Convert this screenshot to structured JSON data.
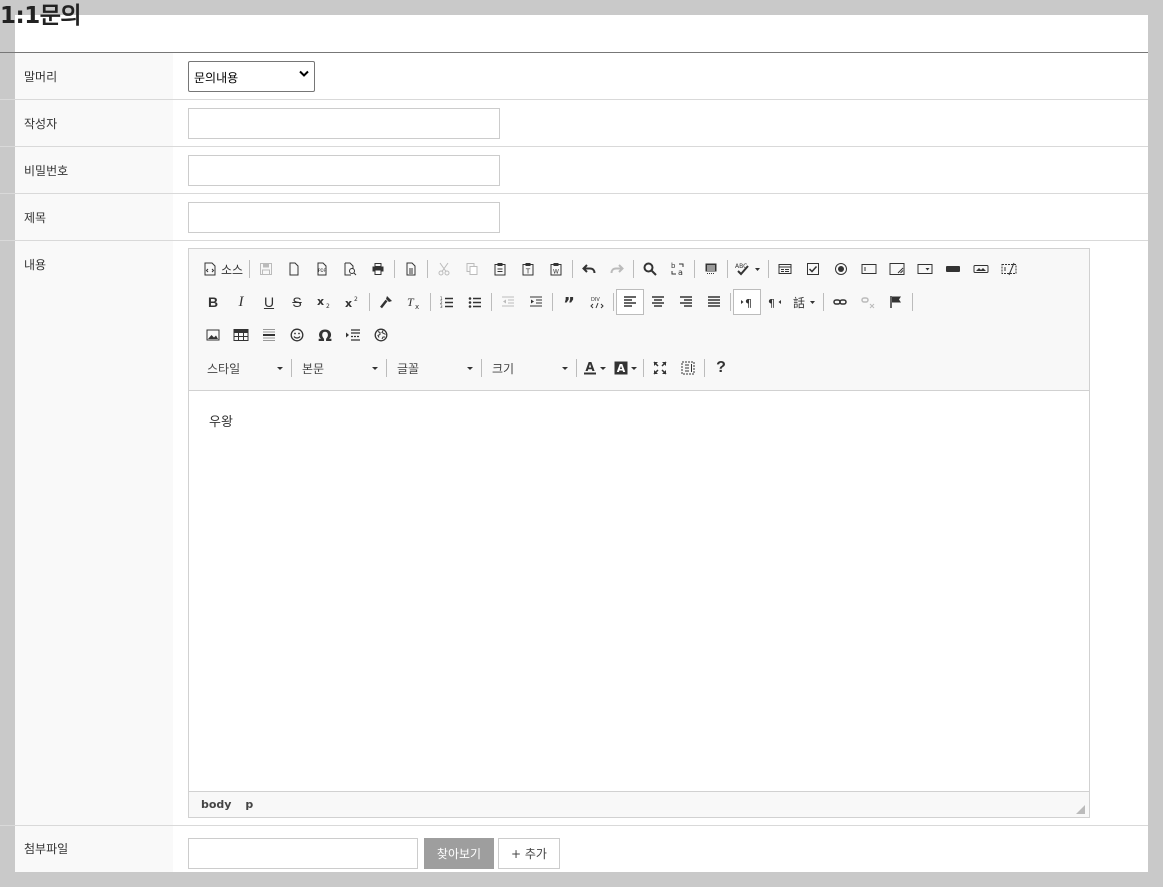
{
  "page": {
    "title": "1:1문의"
  },
  "form": {
    "header": {
      "label": "말머리",
      "selected": "문의내용"
    },
    "author": {
      "label": "작성자",
      "value": ""
    },
    "password": {
      "label": "비밀번호",
      "value": ""
    },
    "subject": {
      "label": "제목",
      "value": ""
    },
    "content": {
      "label": "내용"
    },
    "attachment": {
      "label": "첨부파일",
      "browse_label": "찾아보기",
      "add_label": "+ 추가"
    }
  },
  "editor": {
    "source_label": "소스",
    "combos": {
      "style": "스타일",
      "format": "본문",
      "font": "글꼴",
      "size": "크기"
    },
    "content_text": "우왕",
    "path": [
      "body",
      "p"
    ],
    "icons": [
      "source-icon",
      "save-icon",
      "new-page-icon",
      "pdf-icon",
      "preview-icon",
      "print-icon",
      "templates-icon",
      "cut-icon",
      "copy-icon",
      "paste-icon",
      "paste-text-icon",
      "paste-word-icon",
      "undo-icon",
      "redo-icon",
      "find-icon",
      "replace-icon",
      "select-all-icon",
      "spellcheck-icon",
      "form-icon",
      "checkbox-icon",
      "radio-icon",
      "textfield-icon",
      "textarea-icon",
      "select-icon",
      "button-icon",
      "imagebutton-icon",
      "hiddenfield-icon",
      "bold-icon",
      "italic-icon",
      "underline-icon",
      "strike-icon",
      "subscript-icon",
      "superscript-icon",
      "copy-format-icon",
      "remove-format-icon",
      "numbered-list-icon",
      "bulleted-list-icon",
      "outdent-icon",
      "indent-icon",
      "blockquote-icon",
      "div-icon",
      "align-left-icon",
      "align-center-icon",
      "align-right-icon",
      "justify-icon",
      "ltr-icon",
      "rtl-icon",
      "language-icon",
      "link-icon",
      "unlink-icon",
      "anchor-icon",
      "image-icon",
      "table-icon",
      "horizontal-rule-icon",
      "smiley-icon",
      "special-char-icon",
      "page-break-icon",
      "iframe-icon",
      "text-color-icon",
      "bg-color-icon",
      "maximize-icon",
      "show-blocks-icon",
      "help-icon"
    ]
  }
}
